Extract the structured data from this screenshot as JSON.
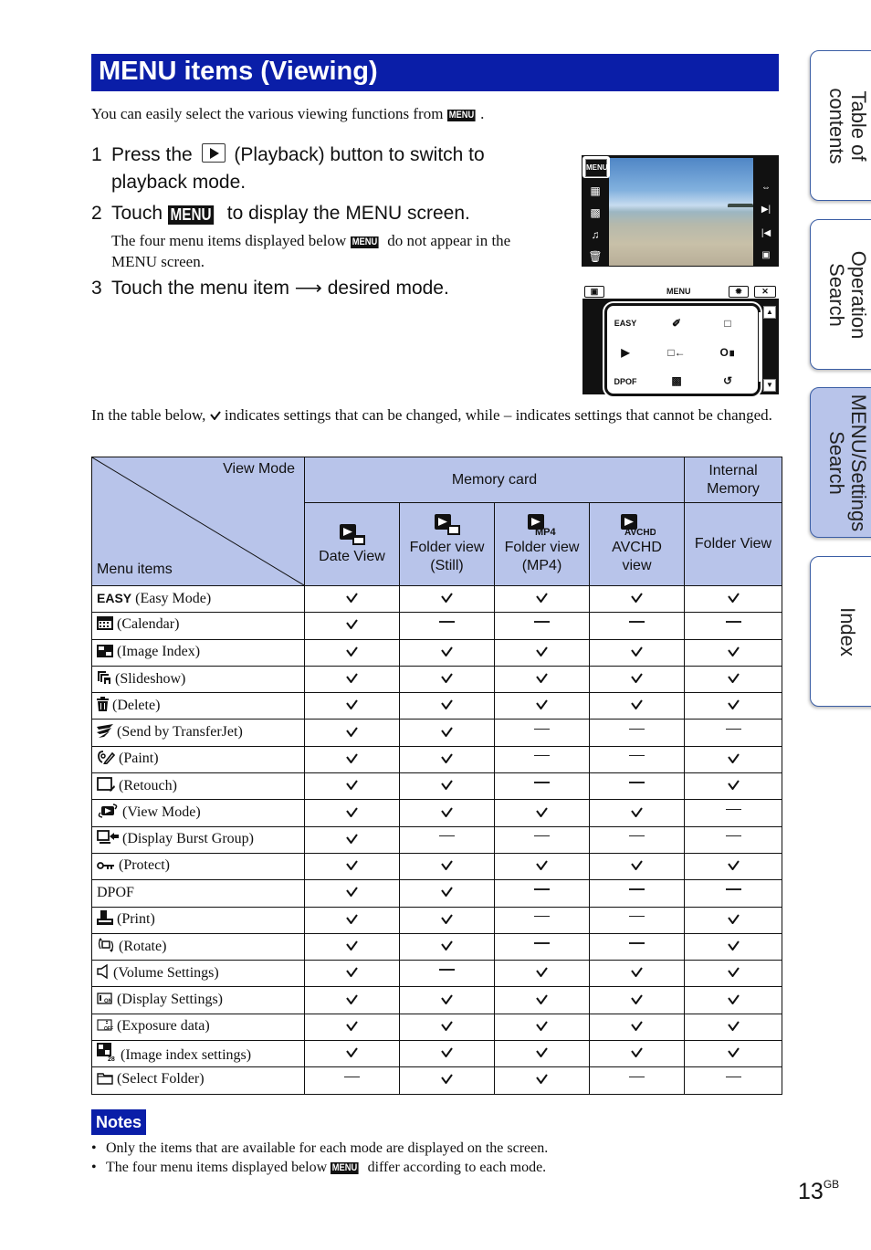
{
  "title": "MENU items (Viewing)",
  "intro": {
    "text": "You can easily select the various viewing functions from",
    "menu_badge": "MENU",
    "suffix": "."
  },
  "steps": [
    {
      "num": "1",
      "pre": "Press the",
      "icon": "playback-button-icon",
      "post": "(Playback) button to switch to",
      "line2": "playback mode."
    },
    {
      "num": "2",
      "pre": "Touch",
      "menu_badge": "MENU",
      "post": "to display the MENU screen."
    },
    {
      "num": "3",
      "pre": "Touch the menu item",
      "arrow": "⟶",
      "post": "desired mode."
    }
  ],
  "step2_sub": {
    "pre": "The four menu items displayed below",
    "menu_badge": "MENU",
    "post": "do not appear in the",
    "line2": "MENU screen."
  },
  "camera_screen_1": {
    "menu_button": "MENU",
    "left_icons": [
      "calendar-icon",
      "image-index-icon",
      "slideshow-icon",
      "delete-icon"
    ],
    "right_icons": [
      "zoom-width-icon",
      "next-icon",
      "previous-icon",
      "shooting-mode-icon"
    ]
  },
  "camera_screen_2": {
    "title": "MENU",
    "top_icons": [
      "toolbox-icon",
      "settings-gear-icon",
      "close-icon"
    ],
    "items": [
      [
        "EASY",
        "paint-icon",
        "retouch-icon"
      ],
      [
        "view-mode-icon",
        "display-burst-group-icon",
        "protect-icon"
      ],
      [
        "DPOF",
        "print-icon",
        "rotate-icon"
      ]
    ],
    "scroll": [
      "scroll-up-icon",
      "scroll-down-icon"
    ]
  },
  "legend_text": {
    "pre": "In the table below,",
    "check_symbol": "check-icon",
    "post": "indicates settings that can be changed, while – indicates settings that cannot be changed."
  },
  "table": {
    "corner_top": "View Mode",
    "corner_bottom": "Menu items",
    "groups": [
      {
        "label": "Memory card",
        "span": 4
      },
      {
        "label": "Internal Memory",
        "span": 1
      }
    ],
    "columns": [
      {
        "icon": "date-view-icon",
        "label_1": "Date View",
        "label_2": ""
      },
      {
        "icon": "folder-view-still-icon",
        "label_1": "Folder view",
        "label_2": "(Still)"
      },
      {
        "icon": "folder-view-mp4-icon",
        "icon_text": "MP4",
        "label_1": "Folder view",
        "label_2": "(MP4)"
      },
      {
        "icon": "avchd-view-icon",
        "icon_text": "AVCHD",
        "label_1": "AVCHD",
        "label_2": "view"
      },
      {
        "icon": "",
        "label_1": "Folder View",
        "label_2": ""
      }
    ],
    "rows": [
      {
        "icon": "easy-icon",
        "icon_text": "EASY",
        "label": "(Easy Mode)",
        "values": [
          "check",
          "check",
          "check",
          "check",
          "check"
        ]
      },
      {
        "icon": "calendar-icon",
        "label": "(Calendar)",
        "values": [
          "check",
          "dash",
          "dash",
          "dash",
          "dash"
        ]
      },
      {
        "icon": "image-index-icon",
        "label": "(Image Index)",
        "values": [
          "check",
          "check",
          "check",
          "check",
          "check"
        ]
      },
      {
        "icon": "slideshow-icon",
        "label": "(Slideshow)",
        "values": [
          "check",
          "check",
          "check",
          "check",
          "check"
        ]
      },
      {
        "icon": "delete-icon",
        "label": "(Delete)",
        "values": [
          "check",
          "check",
          "check",
          "check",
          "check"
        ]
      },
      {
        "icon": "transferjet-icon",
        "label": "(Send by TransferJet)",
        "values": [
          "check",
          "check",
          "dash",
          "dash",
          "dash"
        ]
      },
      {
        "icon": "paint-icon",
        "label": "(Paint)",
        "values": [
          "check",
          "check",
          "dash",
          "dash",
          "check"
        ]
      },
      {
        "icon": "retouch-icon",
        "label": "(Retouch)",
        "values": [
          "check",
          "check",
          "dash",
          "dash",
          "check"
        ]
      },
      {
        "icon": "view-mode-icon",
        "label": "(View Mode)",
        "values": [
          "check",
          "check",
          "check",
          "check",
          "dash"
        ]
      },
      {
        "icon": "display-burst-group-icon",
        "label": "(Display Burst Group)",
        "values": [
          "check",
          "dash",
          "dash",
          "dash",
          "dash"
        ]
      },
      {
        "icon": "protect-icon",
        "label": "(Protect)",
        "values": [
          "check",
          "check",
          "check",
          "check",
          "check"
        ]
      },
      {
        "icon": "",
        "label": "DPOF",
        "values": [
          "check",
          "check",
          "dash",
          "dash",
          "dash"
        ]
      },
      {
        "icon": "print-icon",
        "label": "(Print)",
        "values": [
          "check",
          "check",
          "dash",
          "dash",
          "check"
        ]
      },
      {
        "icon": "rotate-icon",
        "label": "(Rotate)",
        "values": [
          "check",
          "check",
          "dash",
          "dash",
          "check"
        ]
      },
      {
        "icon": "volume-icon",
        "label": "(Volume Settings)",
        "values": [
          "check",
          "dash",
          "check",
          "check",
          "check"
        ]
      },
      {
        "icon": "display-settings-icon",
        "label": "(Display Settings)",
        "values": [
          "check",
          "check",
          "check",
          "check",
          "check"
        ]
      },
      {
        "icon": "exposure-data-icon",
        "label": "(Exposure data)",
        "values": [
          "check",
          "check",
          "check",
          "check",
          "check"
        ]
      },
      {
        "icon": "image-index-settings-icon",
        "label": "(Image index settings)",
        "values": [
          "check",
          "check",
          "check",
          "check",
          "check"
        ]
      },
      {
        "icon": "select-folder-icon",
        "label": "(Select Folder)",
        "values": [
          "dash",
          "check",
          "check",
          "dash",
          "dash"
        ]
      }
    ]
  },
  "notes": {
    "badge": "Notes",
    "items": [
      {
        "text": "Only the items that are available for each mode are displayed on the screen."
      },
      {
        "pre": "The four menu items displayed below",
        "menu_badge": "MENU",
        "post": "differ according to each mode."
      }
    ]
  },
  "side_tabs": [
    {
      "label_1": "Table of",
      "label_2": "contents",
      "active": false
    },
    {
      "label_1": "Operation",
      "label_2": "Search",
      "active": false
    },
    {
      "label_1": "MENU/Settings",
      "label_2": "Search",
      "active": true
    },
    {
      "label_1": "Index",
      "label_2": "",
      "active": false
    }
  ],
  "page_number": {
    "num": "13",
    "suffix": "GB"
  },
  "colors": {
    "title_bg": "#0a1ea8",
    "header_bg": "#b8c4ea",
    "tab_border": "#3b5ea5"
  }
}
